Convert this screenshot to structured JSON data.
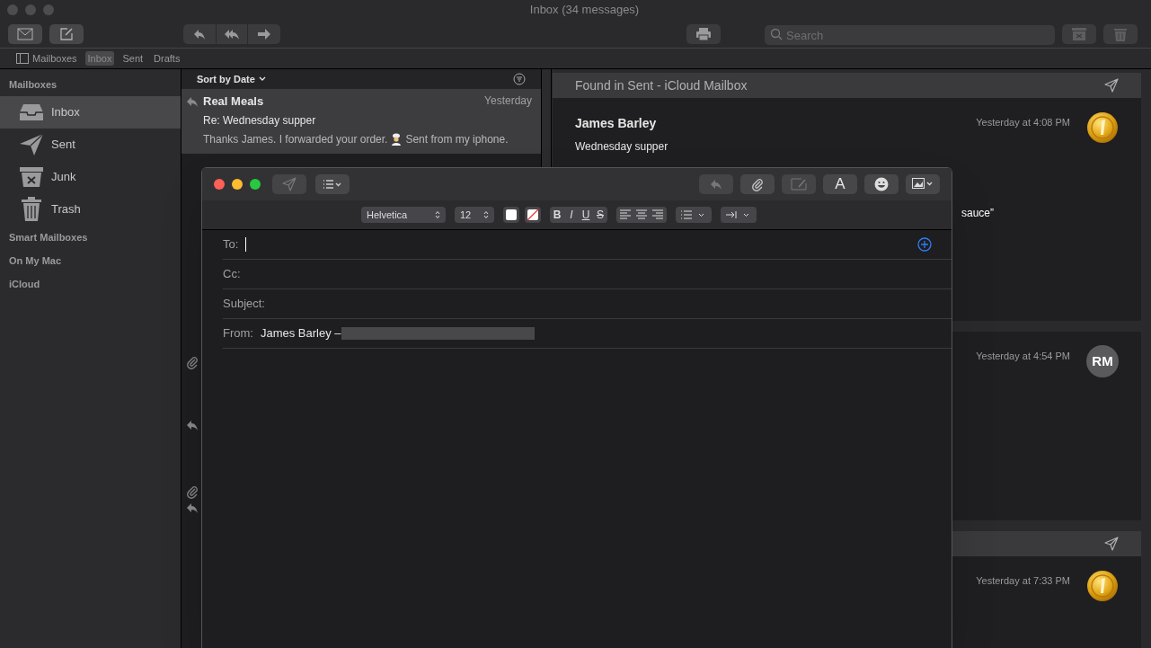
{
  "window": {
    "title": "Inbox (34 messages)"
  },
  "toolbar": {
    "search": {
      "placeholder": "Search"
    }
  },
  "favorites": [
    {
      "label": "Mailboxes",
      "selected": false
    },
    {
      "label": "Inbox",
      "selected": true
    },
    {
      "label": "Sent",
      "selected": false
    },
    {
      "label": "Drafts",
      "selected": false
    }
  ],
  "sidebar": {
    "sections": [
      {
        "title": "Mailboxes",
        "items": [
          {
            "label": "Inbox",
            "selected": true
          },
          {
            "label": "Sent",
            "selected": false
          },
          {
            "label": "Junk",
            "selected": false
          },
          {
            "label": "Trash",
            "selected": false
          }
        ]
      },
      {
        "title": "Smart Mailboxes"
      },
      {
        "title": "On My Mac"
      },
      {
        "title": "iCloud"
      }
    ]
  },
  "message_list": {
    "sort": "Sort by Date",
    "messages": [
      {
        "sender": "Real Meals",
        "date": "Yesterday",
        "subject": "Re: Wednesday supper",
        "preview": [
          "Thanks James. I forwarded your order.",
          "Sent from my iphone."
        ],
        "selected": true,
        "replied": true,
        "attachment": false
      },
      {
        "selected": false,
        "replied": false,
        "attachment": false
      },
      {
        "selected": false,
        "replied": false,
        "attachment": false
      },
      {
        "selected": false,
        "replied": false,
        "attachment": false
      },
      {
        "selected": false,
        "replied": false,
        "attachment": true
      },
      {
        "selected": false,
        "replied": true,
        "attachment": false
      },
      {
        "selected": false,
        "replied": true,
        "attachment": true
      }
    ]
  },
  "conversation": [
    {
      "kind": "sent",
      "header": "Found in Sent - iCloud Mailbox",
      "sender": "James Barley",
      "subject": "Wednesday supper",
      "date": "Yesterday at 4:08 PM",
      "avatar": {
        "kind": "badge"
      },
      "body": "sauce”"
    },
    {
      "kind": "received",
      "date": "Yesterday at 4:54 PM",
      "avatar": {
        "kind": "initials",
        "text": "RM"
      }
    },
    {
      "kind": "sent",
      "date": "Yesterday at 7:33 PM",
      "avatar": {
        "kind": "badge"
      }
    }
  ],
  "compose": {
    "font": "Helvetica",
    "size": "12",
    "styles": [
      "B",
      "I",
      "U",
      "S"
    ],
    "font_button": "A",
    "fields": [
      {
        "label": "To:",
        "focused": true
      },
      {
        "label": "Cc:",
        "focused": false
      },
      {
        "label": "Subject:",
        "focused": false
      },
      {
        "label": "From:",
        "focused": false,
        "value": "James Barley –",
        "redacted": true
      }
    ]
  }
}
